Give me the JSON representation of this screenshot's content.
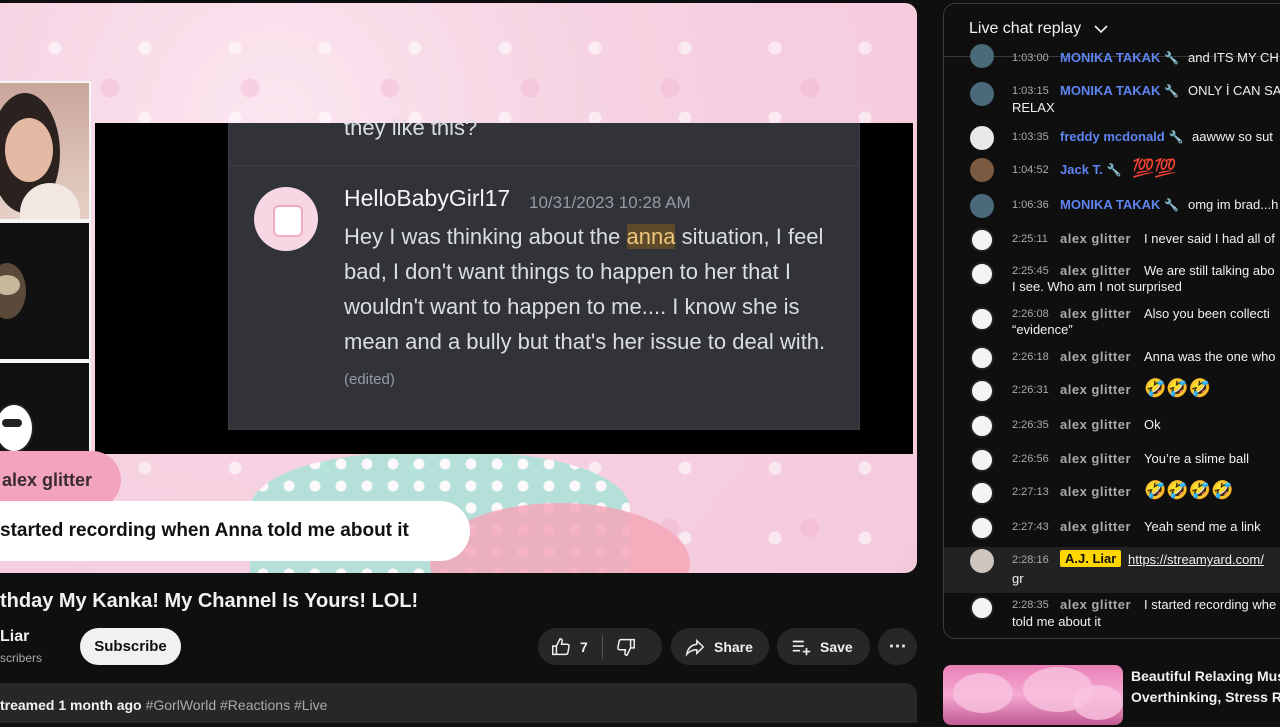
{
  "video": {
    "discord": {
      "top_text": "they like this?",
      "username": "HelloBabyGirl17",
      "timestamp": "10/31/2023 10:28 AM",
      "message_before": "Hey I was thinking about the ",
      "message_highlight": "anna",
      "message_after": " situation,  I feel bad, I don't want things to happen to her that I wouldn't want to happen to me.... I know she is mean and a bully but that's her issue to deal with. ",
      "edited_label": "(edited)"
    },
    "name_tag": "alex glitter",
    "caption": "started recording when Anna told me about it"
  },
  "meta": {
    "title": "thday My Kanka! My Channel Is Yours! LOL!",
    "channel_name": "Liar",
    "subscribers": "scribers",
    "subscribe_label": "Subscribe",
    "like_count": "7",
    "share_label": "Share",
    "save_label": "Save",
    "more_label": "⋯",
    "desc_prefix": "treamed 1 month ago",
    "desc_tags": "#GorlWorld #Reactions #Live"
  },
  "chat": {
    "title": "Live chat replay",
    "messages": [
      {
        "time": "1:03:00",
        "author": "MONIKA TAKAK",
        "text": "and ITS MY CH"
      },
      {
        "time": "1:03:15",
        "author": "MONIKA TAKAK",
        "text": "ONLY İ CAN SA",
        "text2": "RELAX"
      },
      {
        "time": "1:03:35",
        "author": "freddy mcdonald",
        "text": "aawww so sut"
      },
      {
        "time": "1:04:52",
        "author": "Jack T.",
        "text": "💯💯"
      },
      {
        "time": "1:06:36",
        "author": "MONIKA TAKAK",
        "text": "omg im brad...h"
      },
      {
        "time": "2:25:11",
        "author": "alex glitter",
        "text": "I never said I had all of"
      },
      {
        "time": "2:25:45",
        "author": "alex glitter",
        "text": "We are still talking abo",
        "text2": "I see. Who am I not surprised"
      },
      {
        "time": "2:26:08",
        "author": "alex glitter",
        "text": "Also you been collecti",
        "text2": "“evidence”"
      },
      {
        "time": "2:26:18",
        "author": "alex glitter",
        "text": "Anna was the one who"
      },
      {
        "time": "2:26:31",
        "author": "alex glitter",
        "text": "🤣🤣🤣"
      },
      {
        "time": "2:26:35",
        "author": "alex glitter",
        "text": "Ok"
      },
      {
        "time": "2:26:56",
        "author": "alex glitter",
        "text": "You’re a slime ball"
      },
      {
        "time": "2:27:13",
        "author": "alex glitter",
        "text": "🤣🤣🤣🤣"
      },
      {
        "time": "2:27:43",
        "author": "alex glitter",
        "text": "Yeah send me a link"
      },
      {
        "time": "2:28:16",
        "author": "A.J. Liar",
        "text": "https://streamyard.com/",
        "text2": "gr"
      },
      {
        "time": "2:28:35",
        "author": "alex glitter",
        "text": "I started recording whe",
        "text2": "told me about it"
      }
    ]
  },
  "suggested": {
    "title_line1": "Beautiful Relaxing Mus",
    "title_line2": "Overthinking, Stress R"
  },
  "colors": {
    "moderator": "#5e84f1",
    "owner_badge": "#ffd600",
    "pink_overlay": "#f3a3c0"
  }
}
